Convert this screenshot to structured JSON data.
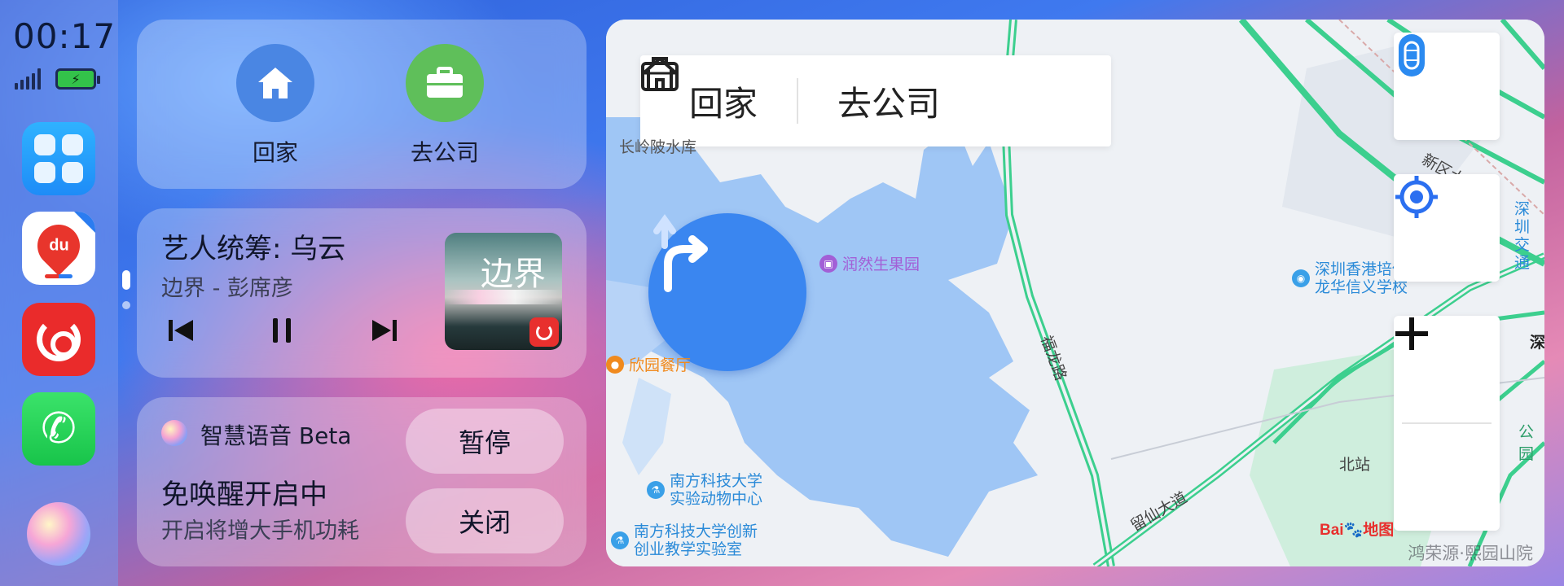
{
  "status_bar": {
    "time": "00:17",
    "battery_icon": "battery-charging-icon",
    "signal_icon": "signal-icon"
  },
  "dock": {
    "apps": [
      {
        "name": "app-grid",
        "icon": "grid-icon"
      },
      {
        "name": "baidu-maps",
        "icon": "map-pin-icon",
        "label": "du"
      },
      {
        "name": "netease-music",
        "icon": "music-icon"
      },
      {
        "name": "phone",
        "icon": "phone-icon"
      },
      {
        "name": "voice-assistant",
        "icon": "voice-orb-icon"
      }
    ]
  },
  "quick_nav": {
    "home_label": "回家",
    "work_label": "去公司",
    "home_color": "#4a86e3",
    "work_color": "#5fbf5a"
  },
  "music": {
    "title": "艺人统筹: 乌云",
    "artist": "边界 - 彭席彦",
    "album_text": "边界",
    "controls": [
      "previous",
      "pause",
      "next"
    ]
  },
  "voice": {
    "title": "智慧语音 Beta",
    "status": "免唤醒开启中",
    "subtitle": "开启将增大手机功耗",
    "pause_label": "暂停",
    "close_label": "关闭"
  },
  "map": {
    "route_home": "回家",
    "route_work": "去公司",
    "pois": [
      {
        "name": "润然生果园",
        "color": "#a25fd6"
      },
      {
        "name": "欣园餐厅",
        "color": "#f08a1e"
      },
      {
        "name": "南方科技大学\n实验动物中心",
        "color": "#3aa0e8"
      },
      {
        "name": "南方科技大学创新\n创业教学实验室",
        "color": "#3aa0e8"
      },
      {
        "name": "深圳香港培侨\n龙华信义学校",
        "color": "#3aa0e8"
      }
    ],
    "labels": {
      "reservoir": "长岭陂水库",
      "road_fulong": "福龙路",
      "road_liuxian": "留仙大道",
      "road_xinqu": "新区大",
      "north_station": "北站",
      "transport": "深圳\n交通",
      "shen": "深",
      "park": "公园"
    },
    "baidu": "Bai",
    "baidu_tail": "地图",
    "watermark": "鸿荣源·熙园山院"
  },
  "colors": {
    "accent_blue": "#3a86f0",
    "road_green": "#3ccf8e",
    "water": "#9fc6f5"
  }
}
